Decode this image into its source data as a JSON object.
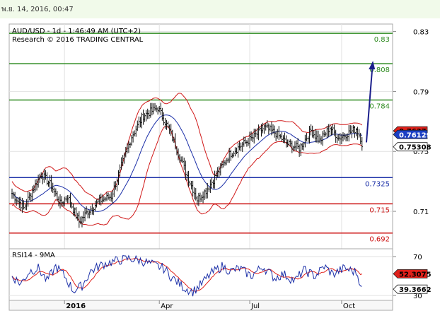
{
  "header": {
    "timestamp": "พ.ย. 14, 2016, 00:47"
  },
  "chart_data": [
    {
      "type": "candlestick",
      "title": "AUD/USD - 1d - 1:46:49 AM (UTC+2)",
      "subtitle": "Research © 2016 TRADING CENTRAL",
      "x_tick_labels": [
        "2016",
        "Apr",
        "Jul",
        "Oct"
      ],
      "y_ticks": [
        "0.83",
        "0.79",
        "0.75",
        "0.71"
      ],
      "ylim": [
        0.685,
        0.835
      ],
      "price_path": [
        [
          0,
          0.722
        ],
        [
          8,
          0.712
        ],
        [
          14,
          0.724
        ],
        [
          20,
          0.735
        ],
        [
          27,
          0.727
        ],
        [
          33,
          0.715
        ],
        [
          38,
          0.72
        ],
        [
          46,
          0.703
        ],
        [
          52,
          0.71
        ],
        [
          60,
          0.717
        ],
        [
          68,
          0.72
        ],
        [
          76,
          0.743
        ],
        [
          82,
          0.76
        ],
        [
          90,
          0.774
        ],
        [
          100,
          0.779
        ],
        [
          108,
          0.764
        ],
        [
          114,
          0.749
        ],
        [
          120,
          0.734
        ],
        [
          127,
          0.718
        ],
        [
          133,
          0.724
        ],
        [
          140,
          0.734
        ],
        [
          149,
          0.748
        ],
        [
          157,
          0.754
        ],
        [
          165,
          0.759
        ],
        [
          173,
          0.766
        ],
        [
          181,
          0.762
        ],
        [
          189,
          0.755
        ],
        [
          197,
          0.752
        ],
        [
          205,
          0.764
        ],
        [
          211,
          0.757
        ],
        [
          218,
          0.766
        ],
        [
          224,
          0.759
        ],
        [
          230,
          0.762
        ],
        [
          236,
          0.765
        ],
        [
          240,
          0.757
        ]
      ],
      "levels": [
        {
          "label": "0.83",
          "value": 0.8288,
          "color": "#2e8b20"
        },
        {
          "label": "0.808",
          "value": 0.8085,
          "color": "#2e8b20"
        },
        {
          "label": "0.784",
          "value": 0.7843,
          "color": "#2e8b20"
        },
        {
          "label": "0.7325",
          "value": 0.7325,
          "color": "#1b2fa8"
        },
        {
          "label": "0.715",
          "value": 0.715,
          "color": "#cc1111"
        },
        {
          "label": "0.692",
          "value": 0.6955,
          "color": "#cc1111"
        }
      ],
      "price_tags": [
        {
          "label": "0.7637",
          "value": 0.7637,
          "bg": "#e0201a",
          "fg": "#000000"
        },
        {
          "label": "0.76129",
          "value": 0.76129,
          "bg": "#1b3fc4",
          "fg": "#ffffff"
        },
        {
          "label": "0.75308",
          "value": 0.75308,
          "bg": "#ffffff",
          "fg": "#000000"
        }
      ],
      "projection": {
        "from": [
          0.756,
          243
        ],
        "to": [
          0.809,
          247
        ]
      }
    },
    {
      "type": "line",
      "title": "RSI14 - 9MA",
      "y_ticks": [
        "70",
        "30"
      ],
      "ylim": [
        25,
        78
      ],
      "rsi_path": [
        [
          0,
          50
        ],
        [
          6,
          42
        ],
        [
          12,
          55
        ],
        [
          18,
          58
        ],
        [
          24,
          45
        ],
        [
          30,
          60
        ],
        [
          36,
          50
        ],
        [
          42,
          35
        ],
        [
          48,
          40
        ],
        [
          54,
          55
        ],
        [
          62,
          62
        ],
        [
          70,
          65
        ],
        [
          80,
          68
        ],
        [
          88,
          66
        ],
        [
          96,
          62
        ],
        [
          104,
          58
        ],
        [
          110,
          48
        ],
        [
          118,
          38
        ],
        [
          124,
          34
        ],
        [
          130,
          42
        ],
        [
          136,
          52
        ],
        [
          144,
          60
        ],
        [
          150,
          55
        ],
        [
          156,
          58
        ],
        [
          164,
          50
        ],
        [
          172,
          60
        ],
        [
          180,
          48
        ],
        [
          186,
          52
        ],
        [
          194,
          45
        ],
        [
          200,
          56
        ],
        [
          208,
          50
        ],
        [
          214,
          60
        ],
        [
          220,
          52
        ],
        [
          228,
          58
        ],
        [
          236,
          54
        ],
        [
          240,
          39.4
        ]
      ],
      "series": [
        {
          "name": "RSI14",
          "color": "#1b2fa8",
          "last": "39.3662"
        },
        {
          "name": "9MA",
          "color": "#e0201a",
          "last": "52.3075"
        }
      ]
    }
  ]
}
